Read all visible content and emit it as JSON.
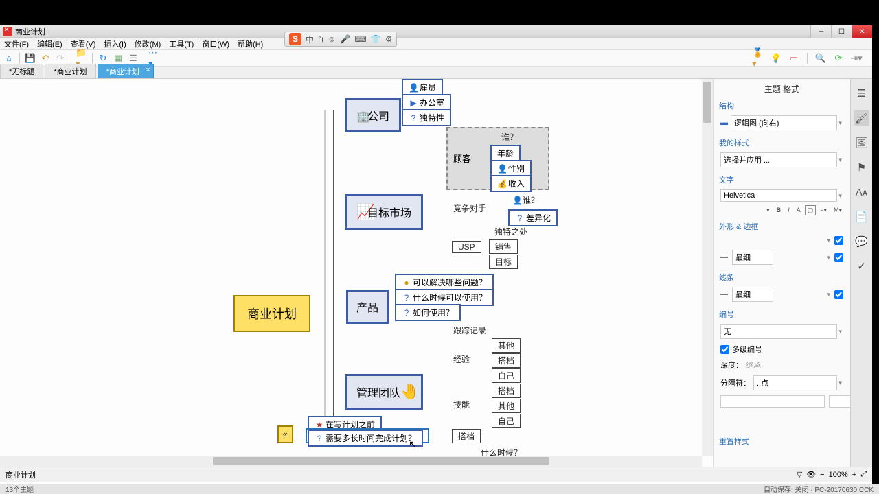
{
  "title": "商业计划",
  "menu": [
    "文件(F)",
    "编辑(E)",
    "查看(V)",
    "插入(I)",
    "修改(M)",
    "工具(T)",
    "窗口(W)",
    "帮助(H)"
  ],
  "tabs": [
    {
      "label": "*无标题",
      "active": false
    },
    {
      "label": "*商业计划",
      "active": false
    },
    {
      "label": "*商业计划",
      "active": true
    }
  ],
  "ime": {
    "mode": "中"
  },
  "mindmap": {
    "central": "商业计划",
    "company": {
      "label": "公司",
      "children": [
        "雇员",
        "办公室",
        "独特性"
      ],
      "icons": [
        "👤",
        "▶",
        "?"
      ]
    },
    "market": {
      "label": "目标市场",
      "customer": {
        "label": "顾客",
        "children": [
          "谁？",
          "年龄",
          "性别",
          "收入"
        ]
      },
      "competitor": {
        "label": "竞争对手",
        "children": [
          "谁？",
          "差异化"
        ]
      },
      "unique_label": "独特之处",
      "usp": {
        "label": "USP",
        "children": [
          "销售",
          "目标"
        ]
      }
    },
    "product": {
      "label": "产品",
      "children": [
        "可以解决哪些问题？",
        "什么时候可以使用？",
        "如何使用？"
      ]
    },
    "team": {
      "label": "管理团队",
      "track": "跟踪记录",
      "exp": {
        "label": "经验",
        "children": [
          "其他",
          "搭档",
          "自己"
        ]
      },
      "skill": {
        "label": "技能",
        "children": [
          "搭档",
          "其他",
          "自己"
        ]
      },
      "partner": "搭档",
      "when": "什么时候？"
    },
    "preplan": {
      "l1": "在写计划之前",
      "l2": "需要多长时间完成计划？"
    }
  },
  "props": {
    "title": "主题 格式",
    "structure_label": "结构",
    "structure_value": "逻辑图 (向右)",
    "mystyle_label": "我的样式",
    "mystyle_value": "选择并应用 ...",
    "text_label": "文字",
    "font_value": "Helvetica",
    "shape_label": "外形 & 边框",
    "shape_value": "最细",
    "line_label": "线条",
    "line_value": "最细",
    "number_label": "编号",
    "number_value": "无",
    "multi_number": "多级编号",
    "depth_label": "深度：",
    "depth_value": "继承",
    "sep_label": "分隔符：",
    "sep_value": ". 点",
    "reset": "重置样式"
  },
  "status": {
    "left": "商业计划",
    "zoom": "100%"
  },
  "footer": {
    "topics": "13个主题",
    "autosave": "自动保存: 关闭",
    "machine": "PC-20170630ICCK"
  },
  "toolbar_icons": {
    "home": "⌂",
    "save": "💾",
    "undo": "↶",
    "redo": "↷",
    "folder": "📁",
    "refresh": "↻",
    "grid": "▦",
    "list": "☰",
    "more": "⋯"
  }
}
